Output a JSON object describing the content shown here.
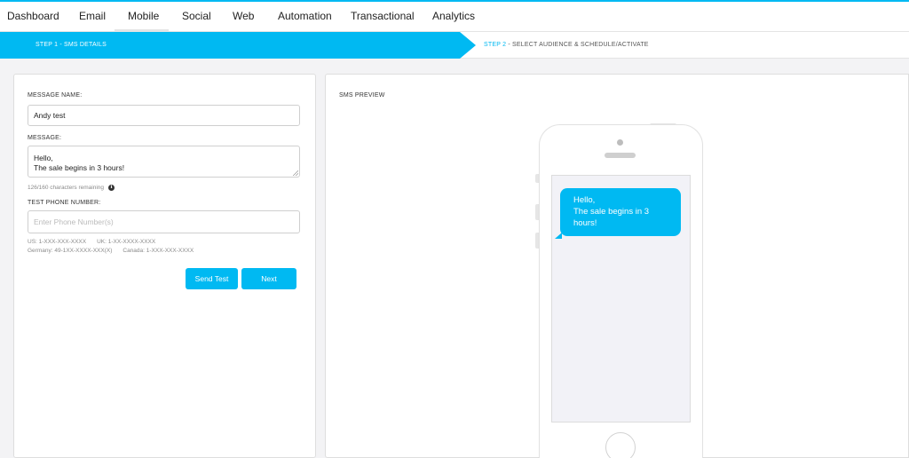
{
  "nav": {
    "items": [
      {
        "label": "Dashboard"
      },
      {
        "label": "Email"
      },
      {
        "label": "Mobile"
      },
      {
        "label": "Social"
      },
      {
        "label": "Web"
      },
      {
        "label": "Automation"
      },
      {
        "label": "Transactional"
      },
      {
        "label": "Analytics"
      }
    ],
    "active": "Mobile"
  },
  "steps": {
    "step1": "STEP 1 - SMS DETAILS",
    "step2_num": "STEP 2",
    "step2_rest": " - SELECT AUDIENCE & SCHEDULE/ACTIVATE"
  },
  "form": {
    "message_name_label": "MESSAGE NAME:",
    "message_name_value": "Andy test",
    "message_label": "MESSAGE:",
    "message_value": "Hello,\nThe sale begins in 3 hours!",
    "char_count": "126/160 characters remaining",
    "test_phone_label": "TEST PHONE NUMBER:",
    "test_phone_placeholder": "Enter Phone Number(s)",
    "formats": {
      "us": "US: 1-XXX-XXX-XXXX",
      "uk": "UK: 1-XX-XXXX-XXXX",
      "germany": "Germany: 49-1XX-XXXX-XXX(X)",
      "canada": "Canada: 1-XXX-XXX-XXXX"
    },
    "send_test_label": "Send Test",
    "next_label": "Next"
  },
  "preview": {
    "label": "SMS PREVIEW",
    "bubble_line1": "Hello,",
    "bubble_line2": "The sale begins in 3 hours!"
  },
  "colors": {
    "accent": "#00b9f2",
    "panel_bg": "#ffffff",
    "page_bg": "#f3f3f5",
    "screen_bg": "#f2f2f7"
  }
}
